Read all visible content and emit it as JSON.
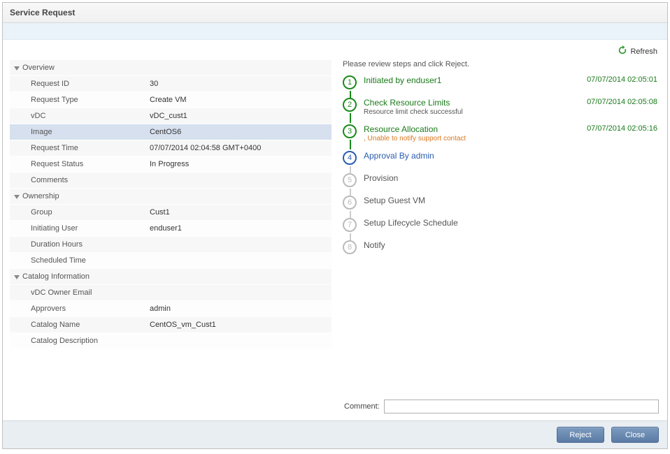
{
  "window": {
    "title": "Service Request"
  },
  "toolbar": {
    "refresh": "Refresh"
  },
  "sections": {
    "overview": {
      "title": "Overview",
      "request_id_label": "Request ID",
      "request_id_value": "30",
      "request_type_label": "Request Type",
      "request_type_value": "Create VM",
      "vdc_label": "vDC",
      "vdc_value": "vDC_cust1",
      "image_label": "Image",
      "image_value": "CentOS6",
      "request_time_label": "Request Time",
      "request_time_value": "07/07/2014 02:04:58 GMT+0400",
      "request_status_label": "Request Status",
      "request_status_value": "In Progress",
      "comments_label": "Comments",
      "comments_value": ""
    },
    "ownership": {
      "title": "Ownership",
      "group_label": "Group",
      "group_value": "Cust1",
      "initiating_user_label": "Initiating User",
      "initiating_user_value": "enduser1",
      "duration_hours_label": "Duration Hours",
      "duration_hours_value": "",
      "scheduled_time_label": "Scheduled Time",
      "scheduled_time_value": ""
    },
    "catalog": {
      "title": "Catalog Information",
      "vdc_owner_email_label": "vDC Owner Email",
      "vdc_owner_email_value": "",
      "approvers_label": "Approvers",
      "approvers_value": "admin",
      "catalog_name_label": "Catalog Name",
      "catalog_name_value": "CentOS_vm_Cust1",
      "catalog_desc_label": "Catalog Description",
      "catalog_desc_value": ""
    }
  },
  "workflow": {
    "instruction": "Please review steps and click Reject.",
    "steps": [
      {
        "n": "1",
        "title": "Initiated by enduser1",
        "sub": "",
        "ts": "07/07/2014 02:05:01",
        "state": "done"
      },
      {
        "n": "2",
        "title": "Check Resource Limits",
        "sub": "Resource limit check successful",
        "ts": "07/07/2014 02:05:08",
        "state": "done"
      },
      {
        "n": "3",
        "title": "Resource Allocation",
        "sub": ", Unable to notify support contact",
        "ts": "07/07/2014 02:05:16",
        "state": "warn"
      },
      {
        "n": "4",
        "title": "Approval By admin",
        "sub": "",
        "ts": "",
        "state": "active"
      },
      {
        "n": "5",
        "title": "Provision",
        "sub": "",
        "ts": "",
        "state": "pending"
      },
      {
        "n": "6",
        "title": "Setup Guest VM",
        "sub": "",
        "ts": "",
        "state": "pending"
      },
      {
        "n": "7",
        "title": "Setup Lifecycle Schedule",
        "sub": "",
        "ts": "",
        "state": "pending"
      },
      {
        "n": "8",
        "title": "Notify",
        "sub": "",
        "ts": "",
        "state": "pending"
      }
    ],
    "comment_label": "Comment:",
    "comment_value": ""
  },
  "footer": {
    "reject": "Reject",
    "close": "Close"
  }
}
